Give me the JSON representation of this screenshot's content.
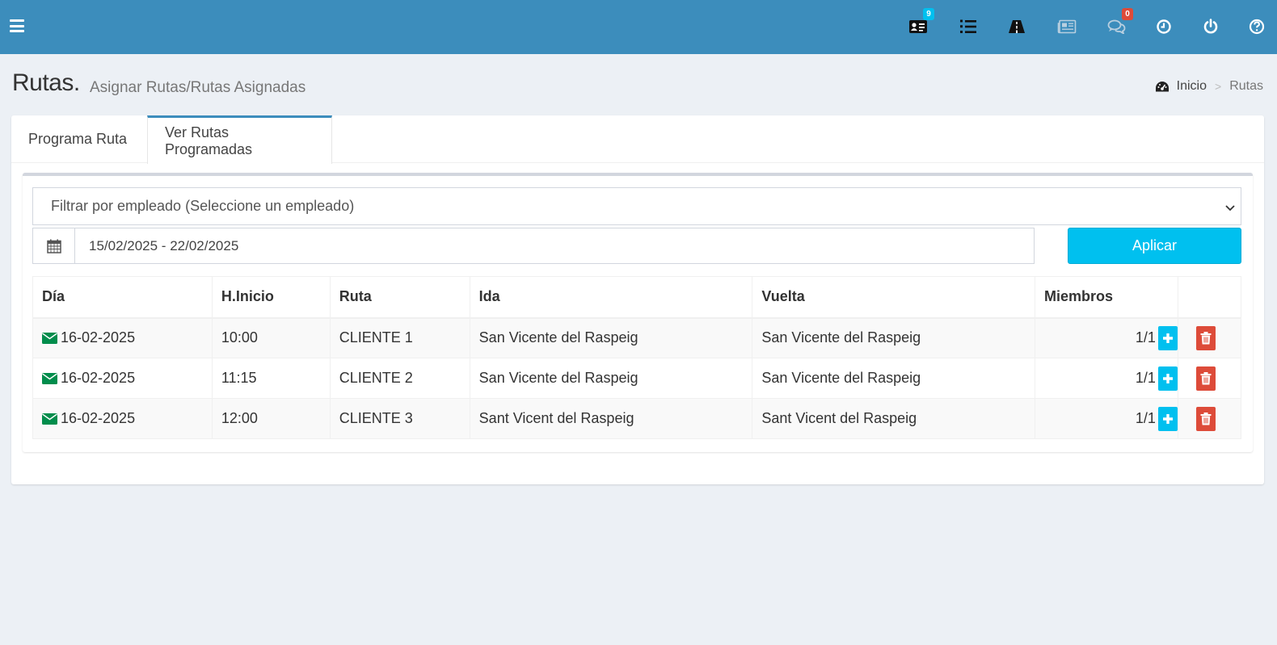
{
  "topbar": {
    "accent_color": "#3c8dbc",
    "icons": [
      {
        "name": "contact-card-icon",
        "badge": "9",
        "badge_color": "#00c0ef"
      },
      {
        "name": "list-ol-icon"
      },
      {
        "name": "road-icon"
      },
      {
        "name": "newspaper-icon"
      },
      {
        "name": "comments-icon",
        "badge": "0",
        "badge_color": "#dd4b39"
      },
      {
        "name": "clock-icon"
      },
      {
        "name": "power-off-icon"
      },
      {
        "name": "question-circle-icon"
      }
    ]
  },
  "header": {
    "title": "Rutas.",
    "subtitle": "Asignar Rutas/Rutas Asignadas",
    "breadcrumb": {
      "home": "Inicio",
      "separator": ">",
      "current": "Rutas"
    }
  },
  "tabs": [
    {
      "label": "Programa Ruta",
      "active": false
    },
    {
      "label": "Ver Rutas Programadas",
      "active": true
    }
  ],
  "filter": {
    "employee_select": "Filtrar por empleado (Seleccione un empleado)",
    "date_range": "15/02/2025 - 22/02/2025",
    "apply_label": "Aplicar"
  },
  "table": {
    "headers": [
      "Día",
      "H.Inicio",
      "Ruta",
      "Ida",
      "Vuelta",
      "Miembros",
      ""
    ],
    "rows": [
      {
        "dia": "16-02-2025",
        "hinicio": "10:00",
        "ruta": "CLIENTE 1",
        "ida": "San Vicente del Raspeig",
        "vuelta": "San Vicente del Raspeig",
        "miembros": "1/1"
      },
      {
        "dia": "16-02-2025",
        "hinicio": "11:15",
        "ruta": "CLIENTE 2",
        "ida": "San Vicente del Raspeig",
        "vuelta": "San Vicente del Raspeig",
        "miembros": "1/1"
      },
      {
        "dia": "16-02-2025",
        "hinicio": "12:00",
        "ruta": "CLIENTE 3",
        "ida": "Sant Vicent del Raspeig",
        "vuelta": "Sant Vicent del Raspeig",
        "miembros": "1/1"
      }
    ]
  }
}
